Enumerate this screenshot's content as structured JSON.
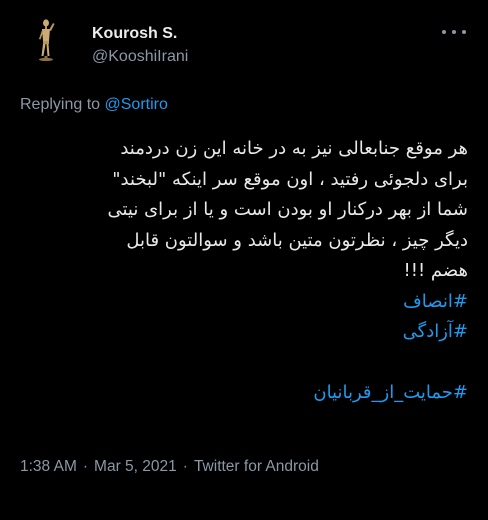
{
  "author": {
    "display_name": "Kourosh S.",
    "handle": "@KooshiIrani"
  },
  "reply": {
    "prefix": "Replying to",
    "mention": "@Sortiro"
  },
  "tweet": {
    "lines": [
      "هر موقع جنابعالی نیز به در خانه این زن دردمند",
      "برای دلجوئی رفتید ، اون موقع سر اینکه \"لبخند\"",
      "شما از بهر درکنار او بودن است و یا از برای نیتی",
      "دیگر چیز ، نظرتون متین باشد و سوالتون قابل",
      "هضم !!!"
    ],
    "hashtags": [
      "#انصاف",
      "#آزادگی"
    ],
    "hashtag_last": "#حمایت_از_قربانیان"
  },
  "meta": {
    "time": "1:38 AM",
    "date": "Mar 5, 2021",
    "client": "Twitter for Android",
    "separator": "·"
  },
  "icons": {
    "more": "more-options-icon",
    "avatar": "wooden-mannequin-avatar"
  }
}
